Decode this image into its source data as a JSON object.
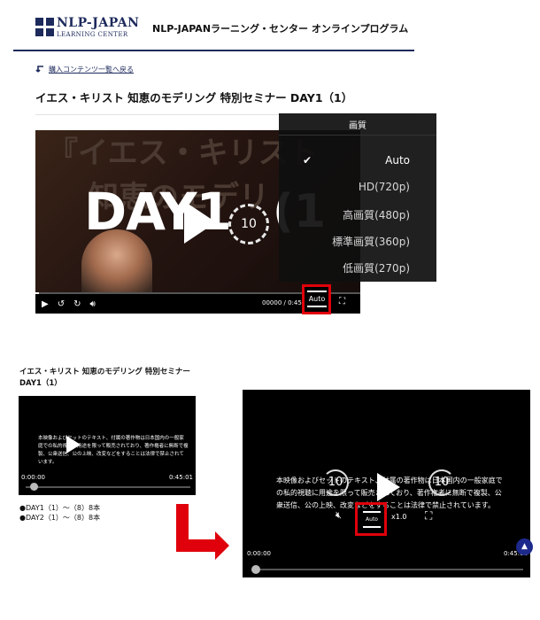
{
  "header": {
    "logo_name": "NLP-JAPAN",
    "logo_sub": "LEARNING CENTER",
    "title": "NLP-JAPANラーニング・センター オンラインプログラム"
  },
  "back_link": {
    "label": "購入コンテンツ一覧へ戻る"
  },
  "lesson": {
    "title": "イエス・キリスト 知恵のモデリング 特別セミナー DAY1（1）"
  },
  "main_player": {
    "poster_text_1": "『イエス・キリスト",
    "poster_text_2": "知恵のモデリ",
    "poster_day": "DAY1",
    "poster_skip": "10",
    "poster_trail": "(1",
    "time": "00000 / 0:45:0",
    "quality_menu": {
      "title": "画質",
      "items": [
        "Auto",
        "HD(720p)",
        "高画質(480p)",
        "標準画質(360p)",
        "低画質(270p)"
      ],
      "selected": "Auto"
    },
    "auto_label": "Auto"
  },
  "small_card": {
    "title": "イエス・キリスト 知恵のモデリング 特別セミナー DAY1（1）",
    "caption": "本映像およびセットのテキスト、付属の著作物は日本国内の一般家庭での私的視聴に用途を限って販売されており、著作権者に無断で複製、公衆送信、公の上映、改変などをすることは法律で禁止されています。",
    "time_start": "0:00:00",
    "time_end": "0:45:01",
    "episodes": [
      "●DAY1（1）～（8）8本",
      "●DAY2（1）～（8）8本"
    ]
  },
  "big_player": {
    "caption": "本映像およびセットのテキスト、付属の著作物は日本国内の一般家庭での私的視聴に用途を限って販売されており、著作権者に無断で複製、公衆送信、公の上映、改変などをすることは法律で禁止されています。",
    "skip_back": "10",
    "skip_fwd": "10",
    "speed": "x1.0",
    "auto_label": "Auto",
    "time_start": "0:00:00",
    "time_end": "0:45:01"
  },
  "colors": {
    "brand": "#1d2a5c",
    "highlight": "#e0000b",
    "scroll_top": "#1d2a8c"
  },
  "icons": [
    "back-arrow-icon",
    "play-icon",
    "replay-10-icon",
    "forward-10-icon",
    "volume-icon",
    "mute-icon",
    "settings-icon",
    "fullscreen-icon",
    "check-icon",
    "chevron-up-icon"
  ]
}
